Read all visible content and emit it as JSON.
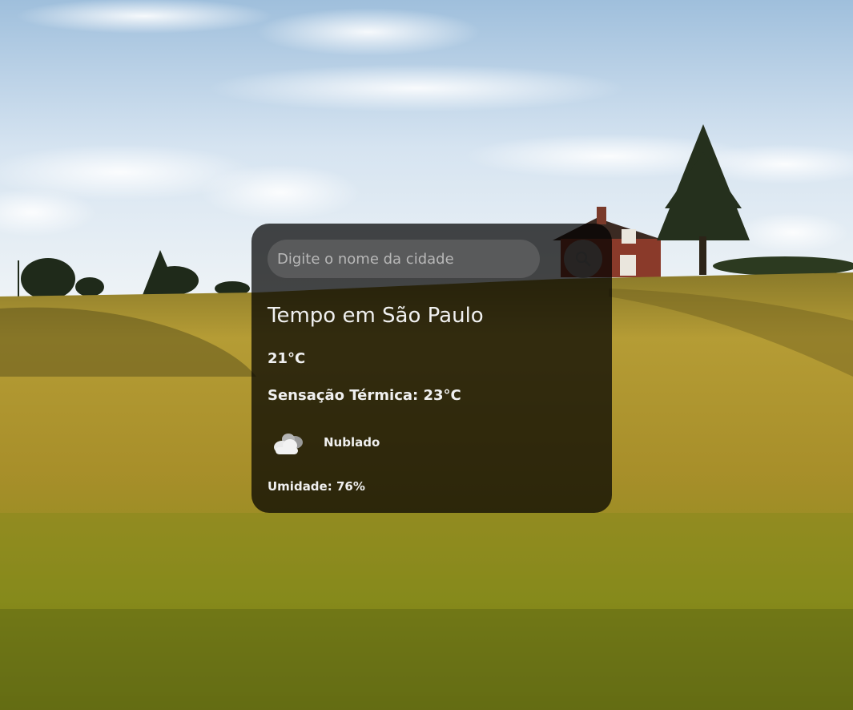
{
  "search": {
    "placeholder": "Digite o nome da cidade",
    "value": ""
  },
  "weather": {
    "title": "Tempo em São Paulo",
    "temperature": "21°C",
    "feels_like": "Sensação Térmica: 23°C",
    "condition": "Nublado",
    "condition_icon": "cloudy-icon",
    "humidity_label": "Umidade: ",
    "humidity_value": "76%"
  },
  "colors": {
    "card_background": "#000000b8",
    "text": "#f0f0f0",
    "input_background": "#787878",
    "field": "#b89a2a",
    "sky": "#cfe0ef"
  }
}
